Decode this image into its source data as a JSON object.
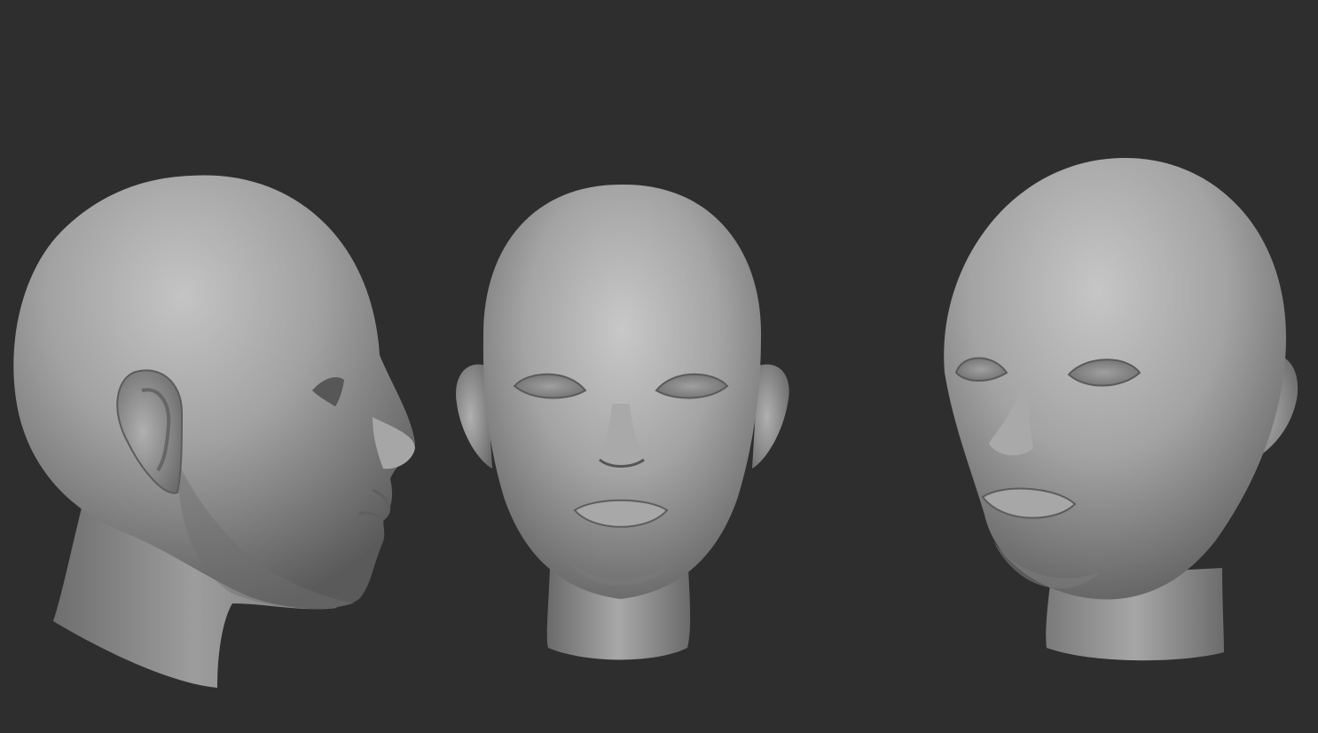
{
  "scene": {
    "background": "#2e2e2e",
    "material_color": "#9a9a9a",
    "views": [
      {
        "name": "side-profile-view"
      },
      {
        "name": "front-view"
      },
      {
        "name": "three-quarter-view"
      }
    ]
  }
}
